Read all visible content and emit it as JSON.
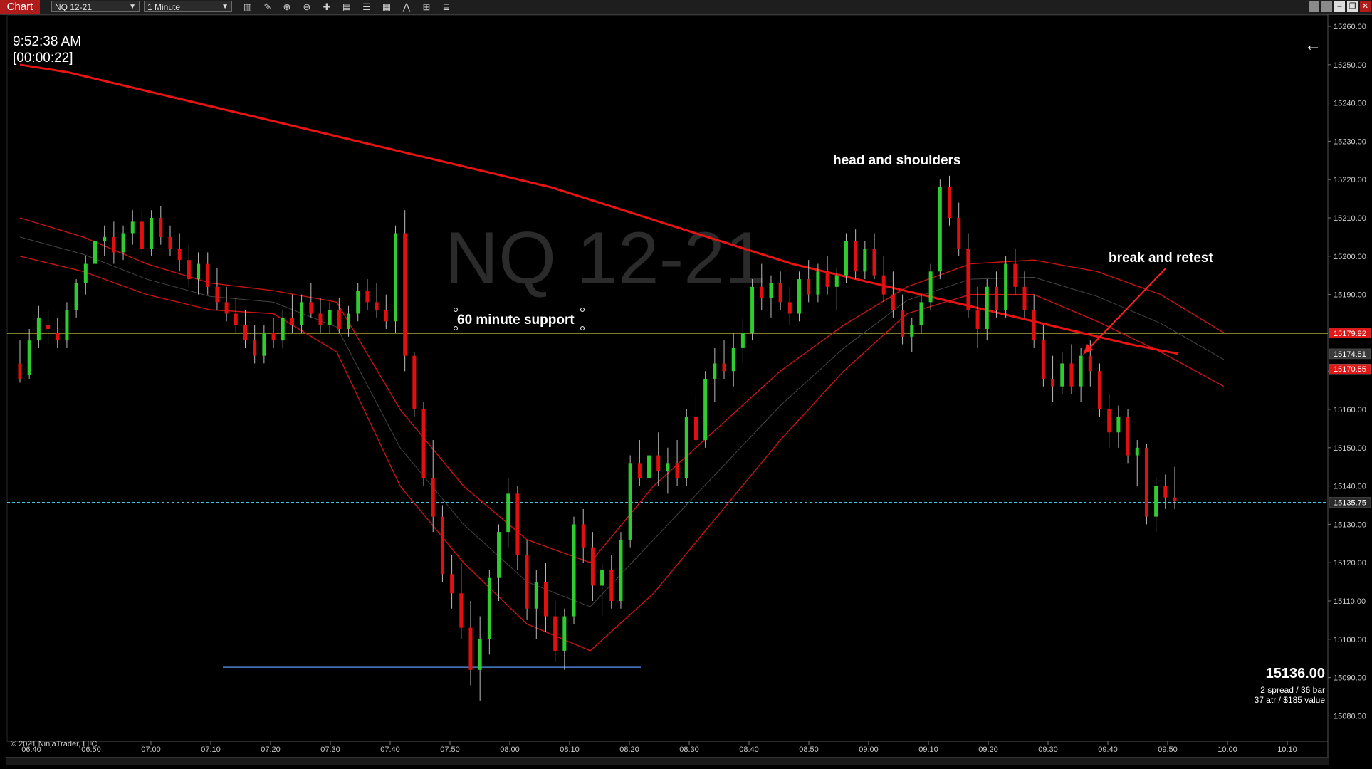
{
  "toolbar": {
    "chart_tab": "Chart",
    "instrument": "NQ 12-21",
    "interval": "1 Minute",
    "icons": [
      "bar-type-icon",
      "draw-tool-icon",
      "zoom-in-icon",
      "zoom-out-icon",
      "crosshair-icon",
      "properties-icon",
      "templates-icon",
      "indicators-icon",
      "strategies-icon",
      "data-box-icon",
      "list-icon"
    ],
    "window_buttons": [
      "minimize",
      "restore",
      "maximize",
      "close"
    ]
  },
  "chart": {
    "watermark": "NQ 12-21",
    "clock": "9:52:38 AM",
    "bar_timer": "[00:00:22]",
    "copyright": "© 2021 NinjaTrader, LLC",
    "colors": {
      "up": "#2ecc2e",
      "down": "#e01010",
      "ma200": "#e81414",
      "support_line": "#c8c83c",
      "last_line": "#3fc8d8",
      "blue_line": "#4a7fd0"
    },
    "annotations": {
      "head_shoulders": "head and shoulders",
      "break_retest": "break and retest",
      "support": "60 minute support"
    },
    "summary": {
      "price": "15136.00",
      "line1": "2 spread / 36 bar",
      "line2": "37 atr / $185 value"
    },
    "price_axis": [
      "15260.00",
      "15250.00",
      "15240.00",
      "15230.00",
      "15220.00",
      "15210.00",
      "15200.00",
      "15190.00",
      "15180.00",
      "15170.00",
      "15160.00",
      "15150.00",
      "15140.00",
      "15130.00",
      "15120.00",
      "15110.00",
      "15100.00",
      "15090.00",
      "15080.00"
    ],
    "price_markers": [
      {
        "label": "15179.92",
        "bg": "#e01818",
        "fg": "#fff"
      },
      {
        "label": "15174.51",
        "bg": "#3a3a3a",
        "fg": "#fff"
      },
      {
        "label": "15170.55",
        "bg": "#e01818",
        "fg": "#fff"
      },
      {
        "label": "15135.75",
        "bg": "#2a2a2a",
        "fg": "#fff"
      }
    ],
    "time_axis": [
      "06:40",
      "06:50",
      "07:00",
      "07:10",
      "07:20",
      "07:30",
      "07:40",
      "07:50",
      "08:00",
      "08:10",
      "08:20",
      "08:30",
      "08:40",
      "08:50",
      "09:00",
      "09:10",
      "09:20",
      "09:30",
      "09:40",
      "09:50",
      "10:00",
      "10:10"
    ],
    "ohlc_series": [
      [
        15172,
        15178,
        15167,
        15168
      ],
      [
        15169,
        15181,
        15168,
        15178
      ],
      [
        15178,
        15187,
        15176,
        15184
      ],
      [
        15182,
        15186,
        15177,
        15181
      ],
      [
        15180,
        15184,
        15176,
        15178
      ],
      [
        15178,
        15188,
        15176,
        15186
      ],
      [
        15186,
        15194,
        15184,
        15193
      ],
      [
        15193,
        15200,
        15190,
        15198
      ],
      [
        15198,
        15205,
        15195,
        15204
      ],
      [
        15204,
        15208,
        15200,
        15205
      ],
      [
        15205,
        15209,
        15198,
        15201
      ],
      [
        15201,
        15208,
        15199,
        15206
      ],
      [
        15206,
        15212,
        15203,
        15209
      ],
      [
        15209,
        15212,
        15200,
        15202
      ],
      [
        15202,
        15212,
        15200,
        15210
      ],
      [
        15210,
        15213,
        15203,
        15205
      ],
      [
        15205,
        15208,
        15200,
        15202
      ],
      [
        15202,
        15206,
        15196,
        15199
      ],
      [
        15199,
        15203,
        15192,
        15194
      ],
      [
        15194,
        15201,
        15190,
        15198
      ],
      [
        15198,
        15201,
        15190,
        15192
      ],
      [
        15192,
        15197,
        15186,
        15188
      ],
      [
        15188,
        15192,
        15183,
        15185
      ],
      [
        15185,
        15189,
        15180,
        15182
      ],
      [
        15182,
        15186,
        15176,
        15178
      ],
      [
        15178,
        15182,
        15172,
        15174
      ],
      [
        15174,
        15182,
        15172,
        15180
      ],
      [
        15180,
        15184,
        15176,
        15178
      ],
      [
        15178,
        15186,
        15176,
        15184
      ],
      [
        15184,
        15190,
        15180,
        15182
      ],
      [
        15182,
        15190,
        15180,
        15188
      ],
      [
        15188,
        15193,
        15184,
        15185
      ],
      [
        15185,
        15189,
        15180,
        15182
      ],
      [
        15182,
        15188,
        15180,
        15186
      ],
      [
        15186,
        15189,
        15180,
        15181
      ],
      [
        15181,
        15187,
        15179,
        15185
      ],
      [
        15185,
        15193,
        15183,
        15191
      ],
      [
        15191,
        15194,
        15186,
        15188
      ],
      [
        15188,
        15193,
        15184,
        15186
      ],
      [
        15186,
        15190,
        15181,
        15183
      ],
      [
        15183,
        15208,
        15180,
        15206
      ],
      [
        15206,
        15212,
        15170,
        15174
      ],
      [
        15174,
        15175,
        15158,
        15160
      ],
      [
        15160,
        15162,
        15140,
        15142
      ],
      [
        15142,
        15152,
        15128,
        15132
      ],
      [
        15132,
        15135,
        15115,
        15117
      ],
      [
        15117,
        15122,
        15108,
        15112
      ],
      [
        15112,
        15120,
        15100,
        15103
      ],
      [
        15103,
        15110,
        15088,
        15092
      ],
      [
        15092,
        15106,
        15084,
        15100
      ],
      [
        15100,
        15118,
        15096,
        15116
      ],
      [
        15116,
        15130,
        15110,
        15128
      ],
      [
        15128,
        15142,
        15124,
        15138
      ],
      [
        15138,
        15140,
        15118,
        15122
      ],
      [
        15122,
        15126,
        15105,
        15108
      ],
      [
        15108,
        15118,
        15100,
        15115
      ],
      [
        15115,
        15120,
        15102,
        15106
      ],
      [
        15106,
        15110,
        15094,
        15097
      ],
      [
        15097,
        15108,
        15092,
        15106
      ],
      [
        15106,
        15132,
        15104,
        15130
      ],
      [
        15130,
        15134,
        15120,
        15124
      ],
      [
        15124,
        15128,
        15110,
        15114
      ],
      [
        15114,
        15120,
        15106,
        15118
      ],
      [
        15118,
        15122,
        15108,
        15110
      ],
      [
        15110,
        15128,
        15108,
        15126
      ],
      [
        15126,
        15148,
        15124,
        15146
      ],
      [
        15146,
        15152,
        15140,
        15142
      ],
      [
        15142,
        15150,
        15136,
        15148
      ],
      [
        15148,
        15154,
        15140,
        15144
      ],
      [
        15144,
        15150,
        15138,
        15146
      ],
      [
        15146,
        15152,
        15140,
        15142
      ],
      [
        15142,
        15160,
        15140,
        15158
      ],
      [
        15158,
        15164,
        15150,
        15152
      ],
      [
        15152,
        15170,
        15150,
        15168
      ],
      [
        15168,
        15176,
        15162,
        15172
      ],
      [
        15172,
        15178,
        15168,
        15170
      ],
      [
        15170,
        15180,
        15166,
        15176
      ],
      [
        15176,
        15184,
        15172,
        15180
      ],
      [
        15180,
        15194,
        15178,
        15192
      ],
      [
        15192,
        15198,
        15186,
        15189
      ],
      [
        15189,
        15195,
        15184,
        15193
      ],
      [
        15193,
        15196,
        15186,
        15188
      ],
      [
        15188,
        15192,
        15182,
        15185
      ],
      [
        15185,
        15196,
        15183,
        15194
      ],
      [
        15194,
        15199,
        15188,
        15190
      ],
      [
        15190,
        15198,
        15188,
        15196
      ],
      [
        15196,
        15200,
        15190,
        15192
      ],
      [
        15192,
        15197,
        15186,
        15195
      ],
      [
        15195,
        15206,
        15193,
        15204
      ],
      [
        15204,
        15207,
        15194,
        15196
      ],
      [
        15196,
        15204,
        15194,
        15202
      ],
      [
        15202,
        15206,
        15194,
        15195
      ],
      [
        15195,
        15200,
        15188,
        15190
      ],
      [
        15190,
        15196,
        15184,
        15186
      ],
      [
        15186,
        15190,
        15177,
        15179
      ],
      [
        15179,
        15184,
        15175,
        15182
      ],
      [
        15182,
        15190,
        15180,
        15188
      ],
      [
        15188,
        15198,
        15186,
        15196
      ],
      [
        15196,
        15220,
        15194,
        15218
      ],
      [
        15218,
        15221,
        15208,
        15210
      ],
      [
        15210,
        15214,
        15200,
        15202
      ],
      [
        15202,
        15206,
        15184,
        15186
      ],
      [
        15186,
        15192,
        15176,
        15181
      ],
      [
        15181,
        15194,
        15178,
        15192
      ],
      [
        15192,
        15196,
        15184,
        15186
      ],
      [
        15186,
        15200,
        15184,
        15198
      ],
      [
        15198,
        15202,
        15190,
        15192
      ],
      [
        15192,
        15196,
        15184,
        15186
      ],
      [
        15186,
        15190,
        15176,
        15178
      ],
      [
        15178,
        15182,
        15166,
        15168
      ],
      [
        15168,
        15174,
        15162,
        15166
      ],
      [
        15166,
        15175,
        15164,
        15172
      ],
      [
        15172,
        15177,
        15164,
        15166
      ],
      [
        15166,
        15176,
        15162,
        15174
      ],
      [
        15174,
        15178,
        15166,
        15170
      ],
      [
        15170,
        15172,
        15158,
        15160
      ],
      [
        15160,
        15164,
        15150,
        15154
      ],
      [
        15154,
        15161,
        15150,
        15158
      ],
      [
        15158,
        15160,
        15146,
        15148
      ],
      [
        15148,
        15152,
        15140,
        15150
      ],
      [
        15150,
        15151,
        15130,
        15132
      ],
      [
        15132,
        15142,
        15128,
        15140
      ],
      [
        15140,
        15143,
        15134,
        15137
      ],
      [
        15137,
        15145,
        15134,
        15136
      ]
    ],
    "ma200": [
      15250,
      15248,
      15245,
      15242,
      15239,
      15236,
      15233,
      15230,
      15227,
      15224,
      15221,
      15218,
      15214,
      15210,
      15206,
      15202,
      15198,
      15195,
      15192,
      15189,
      15186,
      15183,
      15180,
      15177,
      15174.51
    ],
    "envelope_upper": [
      15210,
      15205,
      15198,
      15193,
      15191,
      15188,
      15160,
      15140,
      15126,
      15120,
      15140,
      15155,
      15170,
      15182,
      15192,
      15198,
      15199,
      15196,
      15190,
      15180
    ],
    "envelope_lower": [
      15200,
      15196,
      15190,
      15186,
      15185,
      15175,
      15140,
      15120,
      15104,
      15097,
      15112,
      15132,
      15152,
      15170,
      15185,
      15190,
      15190,
      15183,
      15175,
      15166
    ]
  }
}
